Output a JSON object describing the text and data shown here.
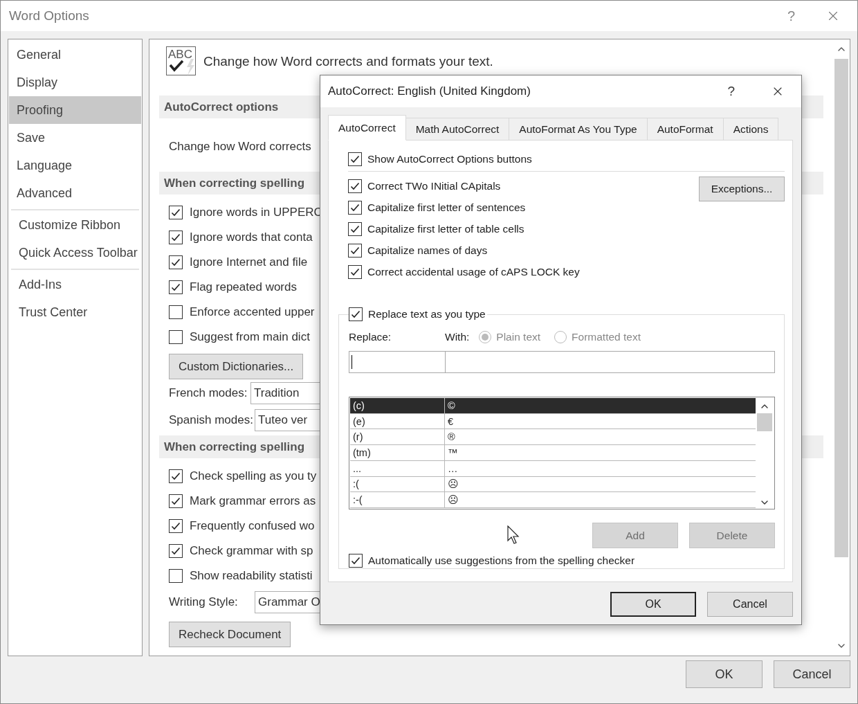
{
  "window": {
    "title": "Word Options",
    "help": "?"
  },
  "sidebar": {
    "groups": [
      [
        {
          "label": "General",
          "selected": false
        },
        {
          "label": "Display",
          "selected": false
        },
        {
          "label": "Proofing",
          "selected": true
        },
        {
          "label": "Save",
          "selected": false
        },
        {
          "label": "Language",
          "selected": false
        },
        {
          "label": "Advanced",
          "selected": false
        }
      ],
      [
        {
          "label": "Customize Ribbon",
          "selected": false
        },
        {
          "label": "Quick Access Toolbar",
          "selected": false
        }
      ],
      [
        {
          "label": "Add-Ins",
          "selected": false
        },
        {
          "label": "Trust Center",
          "selected": false
        }
      ]
    ]
  },
  "content": {
    "icon_text": "ABC",
    "header": "Change how Word corrects and formats your text.",
    "rows": [
      {
        "kind": "heading",
        "label": "AutoCorrect options"
      },
      {
        "kind": "text",
        "label": "Change how Word corrects"
      },
      {
        "kind": "heading",
        "label": "When correcting spelling"
      },
      {
        "kind": "checkbox",
        "label": "Ignore words in UPPERC",
        "checked": true
      },
      {
        "kind": "checkbox",
        "label": "Ignore words that conta",
        "checked": true
      },
      {
        "kind": "checkbox",
        "label": "Ignore Internet and file",
        "checked": true
      },
      {
        "kind": "checkbox",
        "label": "Flag repeated words",
        "checked": true
      },
      {
        "kind": "checkbox",
        "label": "Enforce accented upper",
        "checked": false
      },
      {
        "kind": "checkbox",
        "label": "Suggest from main dict",
        "checked": false
      },
      {
        "kind": "button",
        "label": "Custom Dictionaries..."
      },
      {
        "kind": "select",
        "label": "French modes:",
        "value": "Tradition"
      },
      {
        "kind": "select",
        "label": "Spanish modes:",
        "value": "Tuteo ver"
      },
      {
        "kind": "heading",
        "label": "When correcting spelling"
      },
      {
        "kind": "checkbox",
        "label": "Check spelling as you ty",
        "checked": true
      },
      {
        "kind": "checkbox",
        "label": "Mark grammar errors as",
        "checked": true
      },
      {
        "kind": "checkbox",
        "label": "Frequently confused wo",
        "checked": true
      },
      {
        "kind": "checkbox",
        "label": "Check grammar with sp",
        "checked": true
      },
      {
        "kind": "checkbox",
        "label": "Show readability statisti",
        "checked": false
      },
      {
        "kind": "select",
        "label": "Writing Style:",
        "value": "Grammar O"
      },
      {
        "kind": "button",
        "label": "Recheck Document"
      }
    ]
  },
  "dialog": {
    "title": "AutoCorrect: English (United Kingdom)",
    "help": "?",
    "tabs": [
      {
        "label": "AutoCorrect",
        "selected": true
      },
      {
        "label": "Math AutoCorrect",
        "selected": false
      },
      {
        "label": "AutoFormat As You Type",
        "selected": false
      },
      {
        "label": "AutoFormat",
        "selected": false
      },
      {
        "label": "Actions",
        "selected": false
      }
    ],
    "show_options": {
      "label": "Show AutoCorrect Options buttons",
      "checked": true
    },
    "options": [
      {
        "label": "Correct TWo INitial CApitals",
        "checked": true
      },
      {
        "label": "Capitalize first letter of sentences",
        "checked": true
      },
      {
        "label": "Capitalize first letter of table cells",
        "checked": true
      },
      {
        "label": "Capitalize names of days",
        "checked": true
      },
      {
        "label": "Correct accidental usage of cAPS LOCK key",
        "checked": true
      }
    ],
    "exceptions_button": "Exceptions...",
    "replace_group": {
      "label": "Replace text as you type",
      "checked": true,
      "replace_label": "Replace:",
      "with_label": "With:",
      "radios": [
        {
          "label": "Plain text",
          "selected": true
        },
        {
          "label": "Formatted text",
          "selected": false
        }
      ],
      "rows": [
        {
          "replace": "(c)",
          "with": "©",
          "selected": true
        },
        {
          "replace": "(e)",
          "with": "€",
          "selected": false
        },
        {
          "replace": "(r)",
          "with": "®",
          "selected": false
        },
        {
          "replace": "(tm)",
          "with": "™",
          "selected": false
        },
        {
          "replace": "...",
          "with": "…",
          "selected": false
        },
        {
          "replace": ":(",
          "with": "☹",
          "selected": false
        },
        {
          "replace": ":-(",
          "with": "☹",
          "selected": false
        }
      ],
      "buttons": [
        {
          "label": "Add",
          "disabled": true
        },
        {
          "label": "Delete",
          "disabled": true
        }
      ],
      "auto_suggest": {
        "label": "Automatically use suggestions from the spelling checker",
        "checked": true
      }
    },
    "buttons": [
      {
        "label": "OK",
        "default": true
      },
      {
        "label": "Cancel",
        "default": false
      }
    ]
  },
  "footer": {
    "buttons": [
      {
        "label": "OK"
      },
      {
        "label": "Cancel"
      }
    ]
  }
}
